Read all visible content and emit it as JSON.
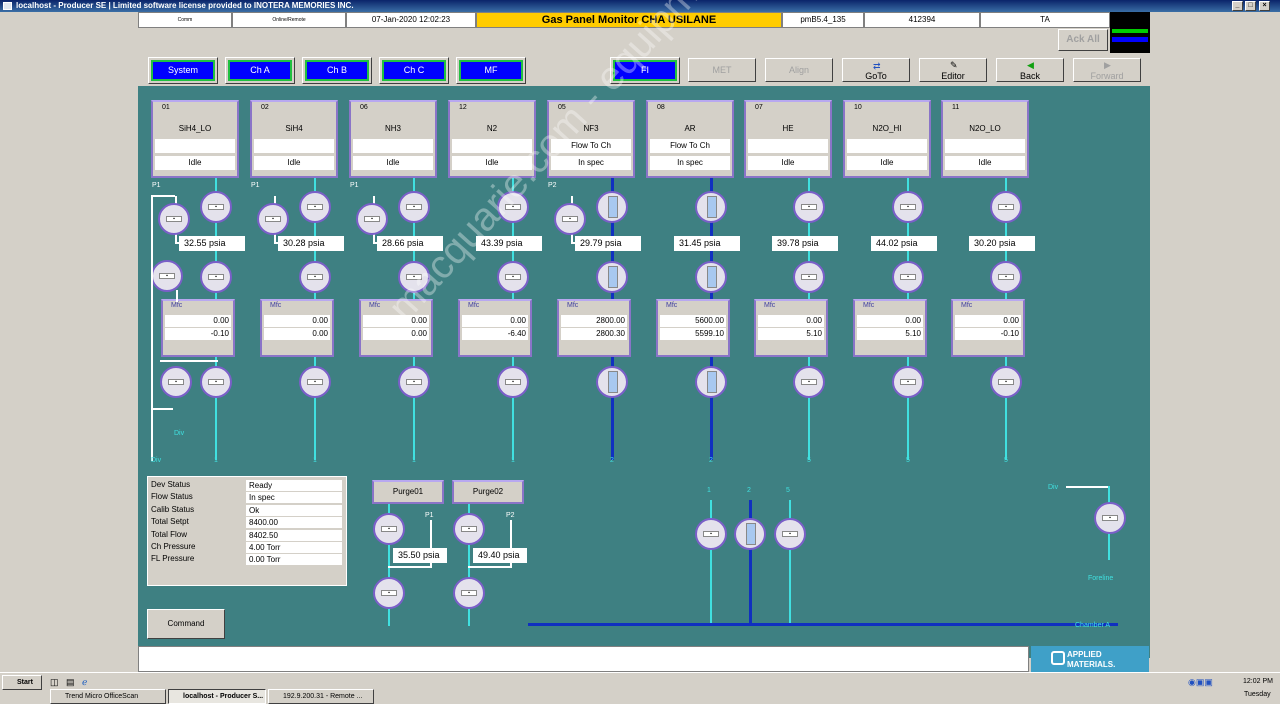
{
  "window": {
    "title": "localhost - Producer SE | Limited software license provided to INOTERA MEMORIES INC."
  },
  "header": {
    "cell1": "Comm",
    "cell2": "Online/Remote",
    "datetime": "07-Jan-2020 12:02:23",
    "title": "Gas Panel Monitor  CHA USILANE",
    "version": "pmB5.4_135",
    "id": "412394",
    "user": "TA",
    "ack_all": "Ack All"
  },
  "nav": [
    "System",
    "Ch A",
    "Ch B",
    "Ch C",
    "MF",
    "FI"
  ],
  "toolbar": {
    "met": "MET",
    "align": "Align",
    "goto": "GoTo",
    "editor": "Editor",
    "back": "Back",
    "forward": "Forward"
  },
  "sources": [
    {
      "num": "01",
      "name": "SiH4_LO",
      "f1": "",
      "f2": "Idle",
      "pres": "32.55 psia",
      "mfc_set": "0.00",
      "mfc_act": "-0.10",
      "bottom": "1"
    },
    {
      "num": "02",
      "name": "SiH4",
      "f1": "",
      "f2": "Idle",
      "pres": "30.28 psia",
      "mfc_set": "0.00",
      "mfc_act": "0.00",
      "bottom": "1"
    },
    {
      "num": "06",
      "name": "NH3",
      "f1": "",
      "f2": "Idle",
      "pres": "28.66 psia",
      "mfc_set": "0.00",
      "mfc_act": "0.00",
      "bottom": "1"
    },
    {
      "num": "12",
      "name": "N2",
      "f1": "",
      "f2": "Idle",
      "pres": "43.39 psia",
      "mfc_set": "0.00",
      "mfc_act": "-6.40",
      "bottom": "1"
    },
    {
      "num": "05",
      "name": "NF3",
      "f1": "Flow To Ch",
      "f2": "In spec",
      "pres": "29.79 psia",
      "mfc_set": "2800.00",
      "mfc_act": "2800.30",
      "bottom": "2"
    },
    {
      "num": "08",
      "name": "AR",
      "f1": "Flow To Ch",
      "f2": "In spec",
      "pres": "31.45 psia",
      "mfc_set": "5600.00",
      "mfc_act": "5599.10",
      "bottom": "2"
    },
    {
      "num": "07",
      "name": "HE",
      "f1": "",
      "f2": "Idle",
      "pres": "39.78 psia",
      "mfc_set": "0.00",
      "mfc_act": "5.10",
      "bottom": "5"
    },
    {
      "num": "10",
      "name": "N2O_HI",
      "f1": "",
      "f2": "Idle",
      "pres": "44.02 psia",
      "mfc_set": "0.00",
      "mfc_act": "5.10",
      "bottom": "5"
    },
    {
      "num": "11",
      "name": "N2O_LO",
      "f1": "",
      "f2": "Idle",
      "pres": "30.20 psia",
      "mfc_set": "0.00",
      "mfc_act": "-0.10",
      "bottom": "5"
    }
  ],
  "mfc_label": "Mfc",
  "labels": {
    "p1": "P1",
    "p2": "P2",
    "div": "Div",
    "foreline": "Foreline",
    "chamber": "Chamber A",
    "m1": "1",
    "m2": "2",
    "m5": "5"
  },
  "status": [
    {
      "k": "Dev Status",
      "v": "Ready"
    },
    {
      "k": "Flow Status",
      "v": "In spec"
    },
    {
      "k": "Calib Status",
      "v": "Ok"
    },
    {
      "k": "Total Setpt",
      "v": "8400.00"
    },
    {
      "k": "Total Flow",
      "v": "8402.50"
    },
    {
      "k": "Ch Pressure",
      "v": "4.00 Torr"
    },
    {
      "k": "FL Pressure",
      "v": "0.00 Torr"
    }
  ],
  "purge": {
    "p01": "Purge01",
    "p02": "Purge02",
    "p01_pres": "35.50 psia",
    "p02_pres": "49.40 psia"
  },
  "command": "Command",
  "brand": {
    "line1": "APPLIED",
    "line2": "MATERIALS."
  },
  "taskbar": {
    "start": "Start",
    "tasks": [
      "Trend Micro OfficeScan",
      "localhost - Producer S...",
      "192.9.200.31 - Remote ..."
    ],
    "time": "12:02 PM",
    "day": "Tuesday"
  },
  "watermark": "macquarie.com - equipment - training"
}
